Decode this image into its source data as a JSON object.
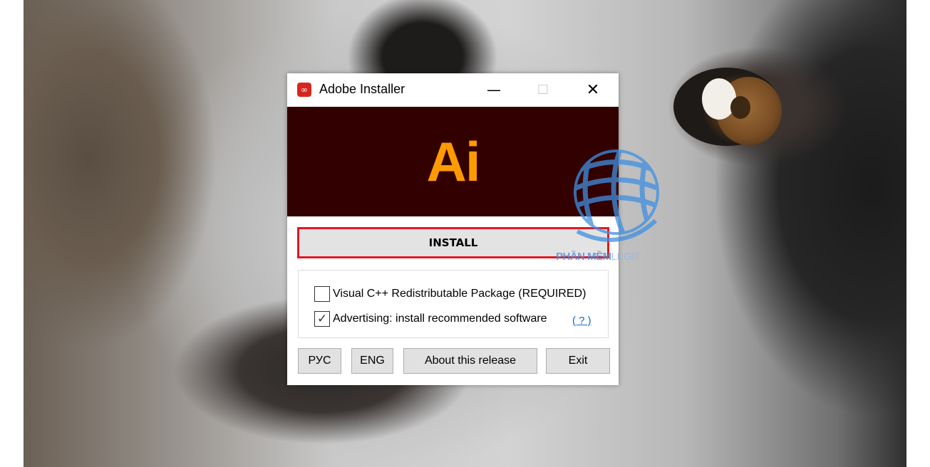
{
  "window": {
    "title": "Adobe Installer",
    "controls": {
      "minimize": "—",
      "maximize": "☐",
      "close": "✕"
    },
    "banner_logo": "Ai",
    "install_label": "INSTALL",
    "options": [
      {
        "label": "Visual C++ Redistributable Package (REQUIRED)",
        "checked": false
      },
      {
        "label": "Advertising: install recommended software",
        "checked": true
      }
    ],
    "help_link": "( ? )",
    "buttons": {
      "rus": "РУС",
      "eng": "ENG",
      "about": "About this release",
      "exit": "Exit"
    }
  },
  "watermark": {
    "bold": "PHẦN MỀM",
    "light": "LEGIT"
  },
  "colors": {
    "banner_bg": "#330000",
    "logo": "#ff9a00",
    "install_border": "#e21823",
    "link": "#1a63c6"
  }
}
